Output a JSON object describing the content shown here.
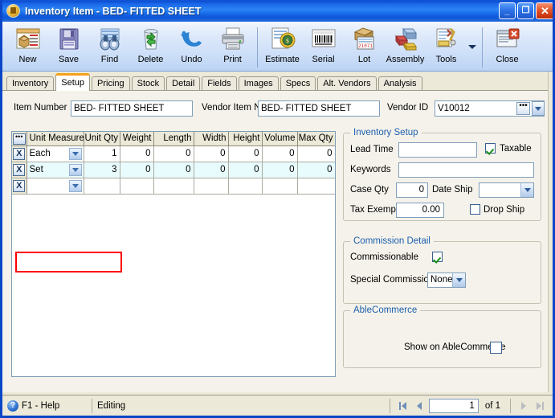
{
  "window": {
    "title_prefix": "Inventory Item",
    "title_sep": " - ",
    "title_item": "BED- FITTED SHEET",
    "minimize_label": "_",
    "maximize_label": "❐",
    "close_label": "✕"
  },
  "toolbar": {
    "items": [
      {
        "label": "New",
        "icon": "new-item-icon"
      },
      {
        "label": "Save",
        "icon": "floppy-disk-icon"
      },
      {
        "label": "Find",
        "icon": "binoculars-icon"
      },
      {
        "label": "Delete",
        "icon": "recycle-bin-icon"
      },
      {
        "label": "Undo",
        "icon": "undo-arrow-icon"
      },
      {
        "label": "Print",
        "icon": "printer-icon"
      },
      {
        "label": "Estimate",
        "icon": "estimate-tag-icon"
      },
      {
        "label": "Serial",
        "icon": "barcode-icon"
      },
      {
        "label": "Lot",
        "icon": "lot-box-icon"
      },
      {
        "label": "Assembly",
        "icon": "assembly-blocks-icon"
      },
      {
        "label": "Tools",
        "icon": "tools-wrench-icon"
      },
      {
        "label": "Close",
        "icon": "close-window-icon"
      }
    ]
  },
  "tabs": [
    {
      "label": "Inventory",
      "active": false
    },
    {
      "label": "Setup",
      "active": true
    },
    {
      "label": "Pricing",
      "active": false
    },
    {
      "label": "Stock",
      "active": false
    },
    {
      "label": "Detail",
      "active": false
    },
    {
      "label": "Fields",
      "active": false
    },
    {
      "label": "Images",
      "active": false
    },
    {
      "label": "Specs",
      "active": false
    },
    {
      "label": "Alt. Vendors",
      "active": false
    },
    {
      "label": "Analysis",
      "active": false
    }
  ],
  "fields": {
    "item_number_label": "Item Number",
    "item_number_value": "BED- FITTED SHEET",
    "vendor_item_no_label": "Vendor Item No",
    "vendor_item_no_value": "BED- FITTED SHEET",
    "vendor_id_label": "Vendor ID",
    "vendor_id_value": "V10012",
    "ellipsis_label": "•••"
  },
  "grid": {
    "selector_header": "•••",
    "columns": [
      "Unit Measure",
      "Unit Qty",
      "Weight",
      "Length",
      "Width",
      "Height",
      "Volume",
      "Max Qty"
    ],
    "row_delete_label": "X",
    "rows": [
      {
        "unit_measure": "Each",
        "unit_qty": "1",
        "weight": "0",
        "length": "0",
        "width": "0",
        "height": "0",
        "volume": "0",
        "max_qty": "0",
        "selected": false
      },
      {
        "unit_measure": "Set",
        "unit_qty": "3",
        "weight": "0",
        "length": "0",
        "width": "0",
        "height": "0",
        "volume": "0",
        "max_qty": "0",
        "selected": true
      },
      {
        "unit_measure": "",
        "unit_qty": "",
        "weight": "",
        "length": "",
        "width": "",
        "height": "",
        "volume": "",
        "max_qty": "",
        "selected": false
      }
    ],
    "highlight_color": "#ff0000"
  },
  "inventory_setup": {
    "legend": "Inventory Setup",
    "lead_time_label": "Lead Time",
    "lead_time_value": "",
    "taxable_label": "Taxable",
    "taxable_checked": true,
    "keywords_label": "Keywords",
    "keywords_value": "",
    "case_qty_label": "Case Qty",
    "case_qty_value": "0",
    "date_ship_label": "Date Ship",
    "date_ship_value": "",
    "tax_exempt_label": "Tax Exempt",
    "tax_exempt_value": "0.00",
    "drop_ship_label": "Drop Ship",
    "drop_ship_checked": false
  },
  "commission_detail": {
    "legend": "Commission Detail",
    "commissionable_label": "Commissionable",
    "commissionable_checked": true,
    "special_commission_label": "Special Commission",
    "special_commission_value": "None"
  },
  "ablecommerce": {
    "legend": "AbleCommerce",
    "show_label": "Show on AbleCommerce",
    "show_checked": false
  },
  "statusbar": {
    "help_icon_label": "?",
    "help_label": "F1 - Help",
    "mode_label": "Editing",
    "page_value": "1",
    "of_label": "of  1"
  },
  "colors": {
    "title_blue": "#1a68e8",
    "accent_orange": "#f3a117",
    "group_legend_blue": "#1d5fae",
    "selected_row": "#e9fcfd",
    "highlight_red": "#ff0000"
  }
}
